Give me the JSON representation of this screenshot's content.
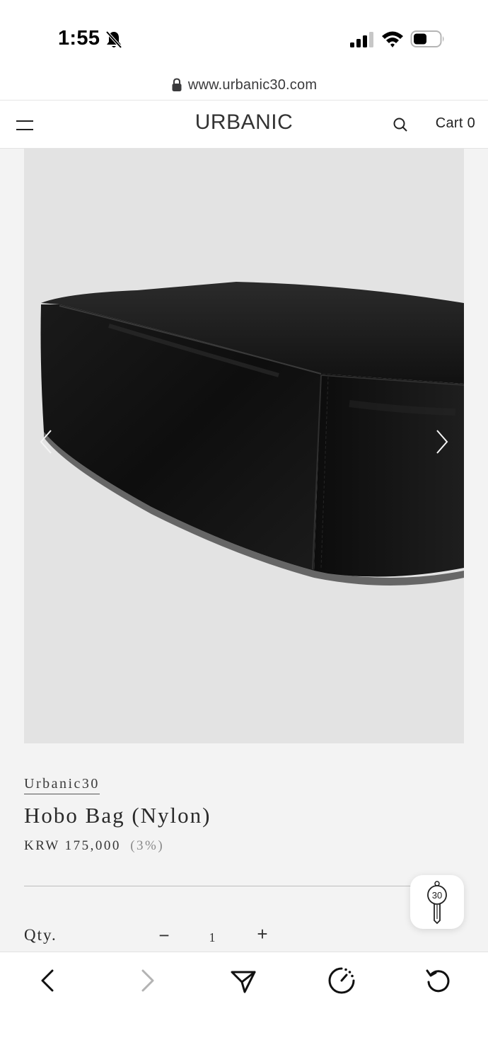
{
  "status_bar": {
    "time": "1:55",
    "icons": [
      "bell-off-icon",
      "signal-icon",
      "wifi-icon",
      "battery-icon"
    ]
  },
  "browser": {
    "url": "www.urbanic30.com",
    "toolbar": [
      "back-icon",
      "forward-icon",
      "share-icon",
      "timer-icon",
      "reload-icon"
    ]
  },
  "header": {
    "logo": "URBANIC",
    "cart_label": "Cart 0",
    "icons": [
      "menu-icon",
      "search-icon"
    ]
  },
  "product": {
    "brand": "Urbanic30",
    "title": "Hobo Bag (Nylon)",
    "price": "KRW 175,000",
    "discount": "(3%)",
    "qty_label": "Qty.",
    "qty_minus": "−",
    "qty_value": "1",
    "qty_plus": "+"
  },
  "widget": {
    "key_label": "30"
  },
  "colors": {
    "page_bg": "#f3f3f3",
    "image_bg": "#e3e3e3",
    "bag": "#141414",
    "text": "#2a2a2a"
  }
}
